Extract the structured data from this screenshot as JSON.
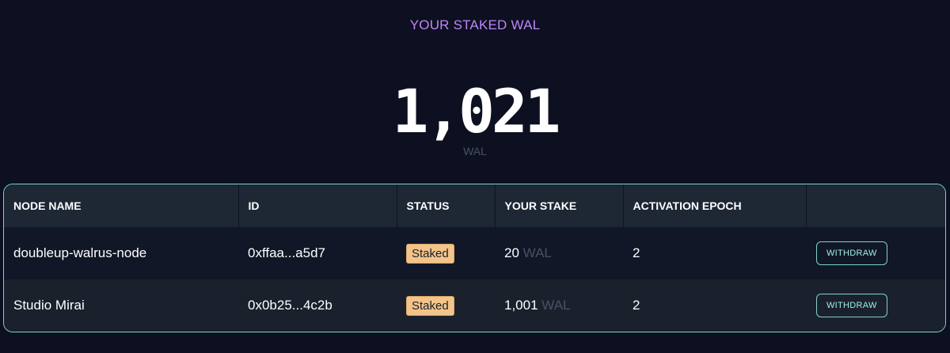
{
  "summary": {
    "heading": "YOUR STAKED WAL",
    "total": "1,021",
    "unit": "WAL"
  },
  "table": {
    "columns": [
      "NODE NAME",
      "ID",
      "STATUS",
      "YOUR STAKE",
      "ACTIVATION EPOCH",
      ""
    ],
    "rows": [
      {
        "node_name": "doubleup-walrus-node",
        "id": "0xffaa...a5d7",
        "status": "Staked",
        "stake_amount": "20",
        "stake_unit": "WAL",
        "activation_epoch": "2",
        "action": "WITHDRAW"
      },
      {
        "node_name": "Studio Mirai",
        "id": "0x0b25...4c2b",
        "status": "Staked",
        "stake_amount": "1,001",
        "stake_unit": "WAL",
        "activation_epoch": "2",
        "action": "WITHDRAW"
      }
    ]
  },
  "colors": {
    "background": "#0c1020",
    "heading": "#c084fc",
    "accent_border": "#7fd3c4",
    "badge": "#f3c48a"
  }
}
